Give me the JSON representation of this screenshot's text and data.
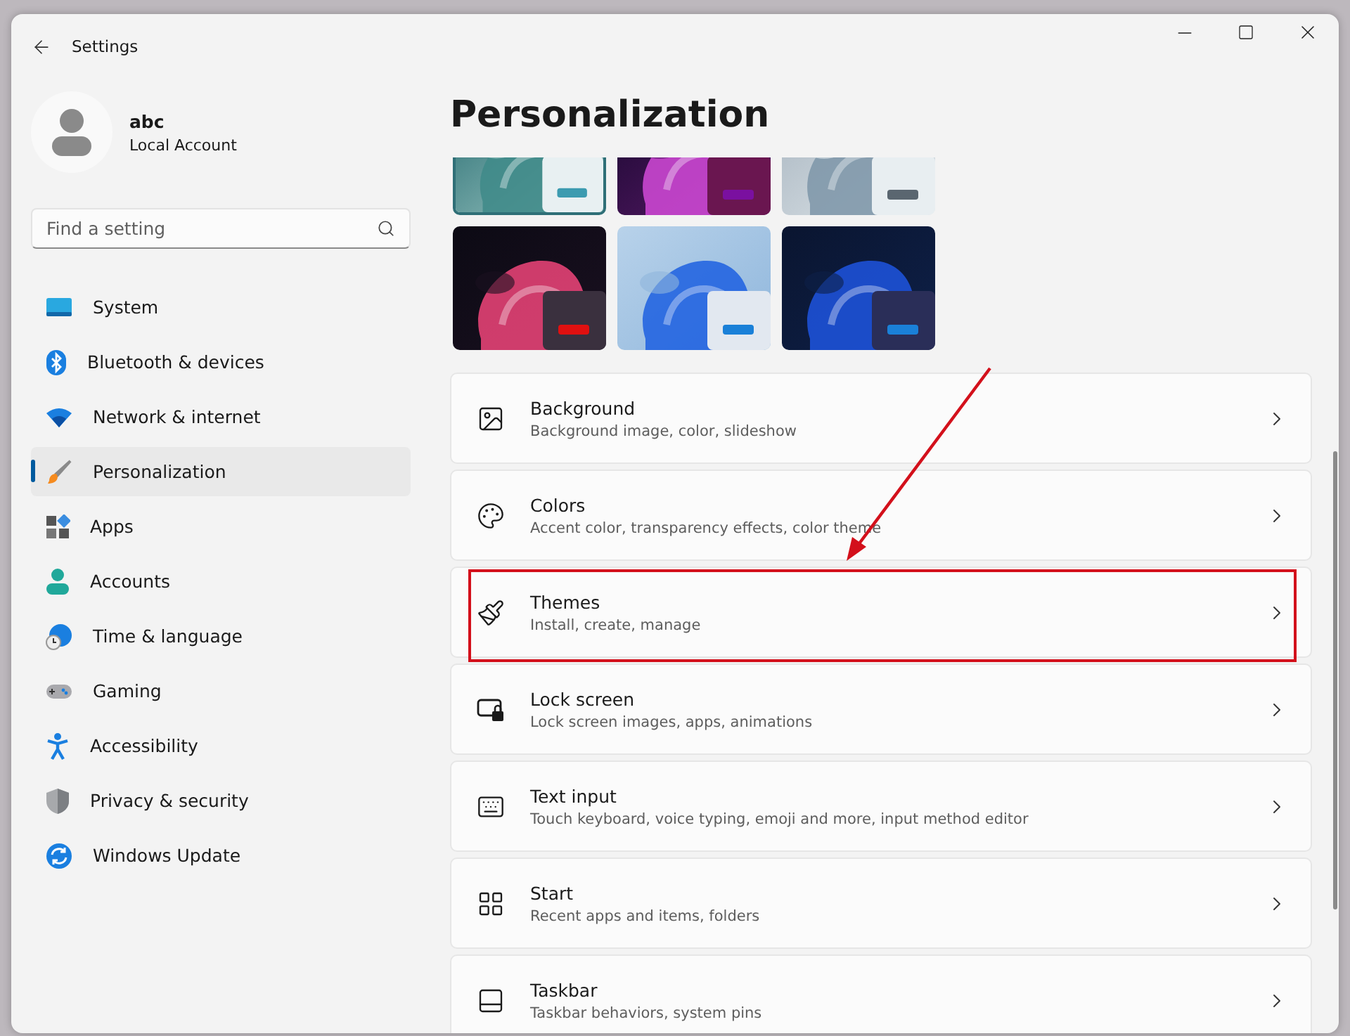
{
  "window": {
    "title": "Settings"
  },
  "account": {
    "name": "abc",
    "type": "Local Account"
  },
  "search": {
    "placeholder": "Find a setting"
  },
  "nav": [
    {
      "label": "System",
      "selected": false
    },
    {
      "label": "Bluetooth & devices",
      "selected": false
    },
    {
      "label": "Network & internet",
      "selected": false
    },
    {
      "label": "Personalization",
      "selected": true
    },
    {
      "label": "Apps",
      "selected": false
    },
    {
      "label": "Accounts",
      "selected": false
    },
    {
      "label": "Time & language",
      "selected": false
    },
    {
      "label": "Gaming",
      "selected": false
    },
    {
      "label": "Accessibility",
      "selected": false
    },
    {
      "label": "Privacy & security",
      "selected": false
    },
    {
      "label": "Windows Update",
      "selected": false
    }
  ],
  "page_title": "Personalization",
  "themes": [
    {
      "kind": "picture",
      "selected": true
    },
    {
      "kind": "picture",
      "selected": false
    },
    {
      "kind": "picture",
      "selected": false
    },
    {
      "kind": "picture",
      "selected": false
    },
    {
      "kind": "picture",
      "selected": false
    },
    {
      "kind": "picture",
      "selected": false
    }
  ],
  "rows": [
    {
      "title": "Background",
      "description": "Background image, color, slideshow",
      "highlighted": false
    },
    {
      "title": "Colors",
      "description": "Accent color, transparency effects, color theme",
      "highlighted": false
    },
    {
      "title": "Themes",
      "description": "Install, create, manage",
      "highlighted": true
    },
    {
      "title": "Lock screen",
      "description": "Lock screen images, apps, animations",
      "highlighted": false
    },
    {
      "title": "Text input",
      "description": "Touch keyboard, voice typing, emoji and more, input method editor",
      "highlighted": false
    },
    {
      "title": "Start",
      "description": "Recent apps and items, folders",
      "highlighted": false
    },
    {
      "title": "Taskbar",
      "description": "Taskbar behaviors, system pins",
      "highlighted": false
    }
  ]
}
